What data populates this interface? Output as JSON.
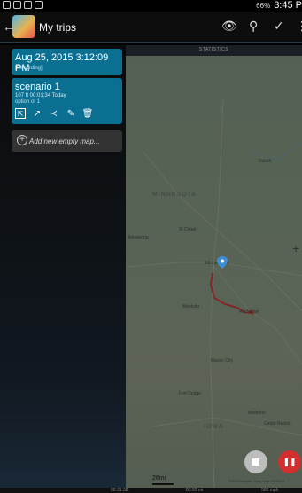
{
  "status_bar": {
    "battery": "66%",
    "time": "3:45 P"
  },
  "action_bar": {
    "title": "My trips",
    "actions": [
      "eye-icon",
      "location-pin-icon",
      "navigate-icon",
      "overflow-icon"
    ]
  },
  "trips": [
    {
      "title": "Aug 25, 2015 3:12:09 PM",
      "subtitle": "[Recording]"
    },
    {
      "title": "scenario 1",
      "meta": "107 ft  00:01:34  Today",
      "option": "option of 1"
    }
  ],
  "add_map_label": "Add new empty map...",
  "map": {
    "tab_label": "STATISTICS",
    "state_label": "MINNESOTA",
    "state_label_2": "IOWA",
    "cities": [
      "Duluth",
      "Alexandria",
      "St Cloud",
      "Minneapolis",
      "Rochester",
      "Mankato",
      "Mason City",
      "Fort Dodge",
      "Cedar Rapids",
      "Waterloo"
    ],
    "scale": "26mi",
    "copyright": "©2015 Google - Map data ©2015 G"
  },
  "bottom_bar": {
    "values": [
      "00:31:38",
      "83.63 mi",
      "500 mph"
    ]
  },
  "colors": {
    "card": "#0b6f92",
    "record": "#d32f2f",
    "route": "#b22222"
  }
}
